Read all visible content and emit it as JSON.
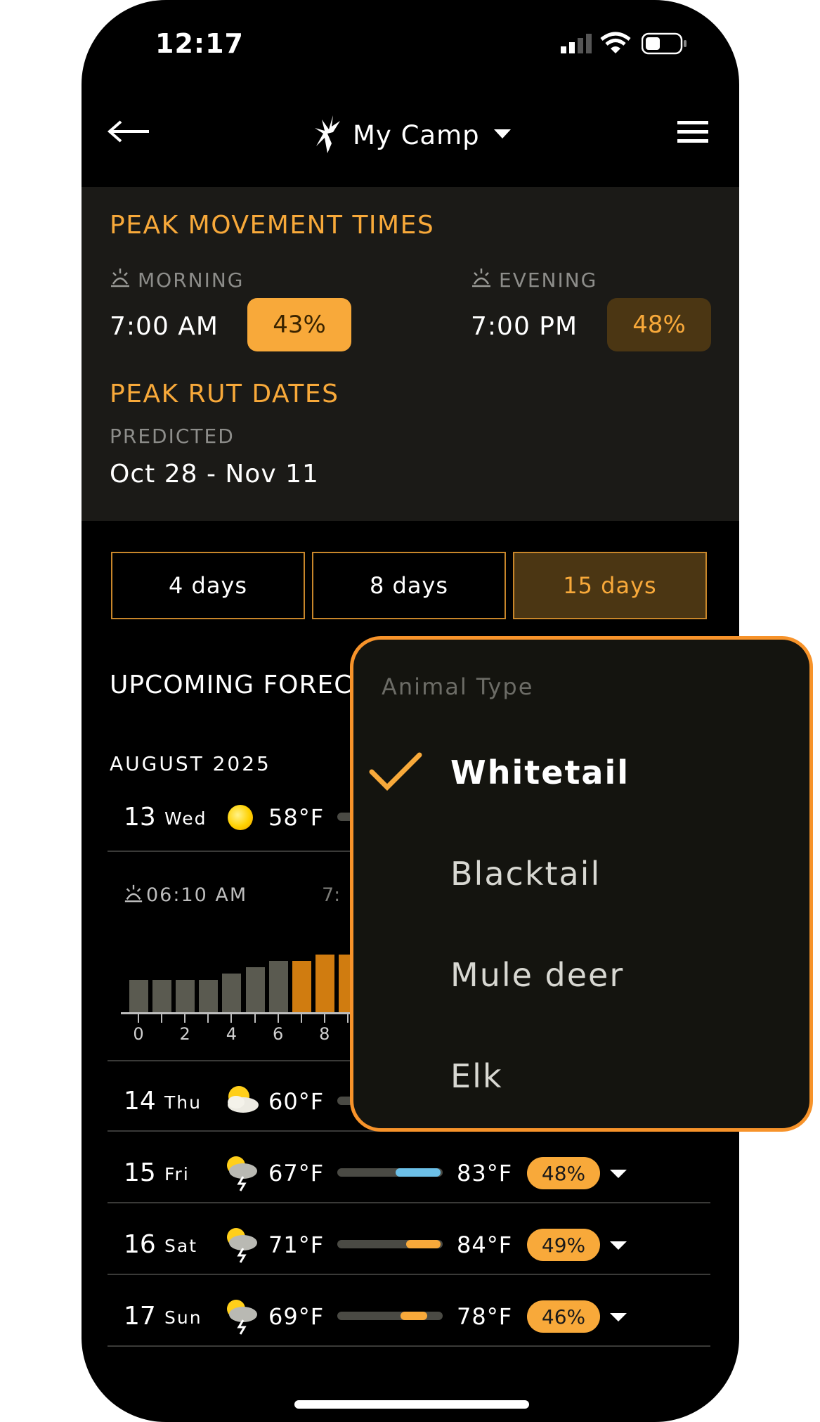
{
  "status_bar": {
    "time": "12:17"
  },
  "header": {
    "camp_name": "My Camp"
  },
  "peak_movement": {
    "title": "PEAK MOVEMENT TIMES",
    "morning": {
      "label": "MORNING",
      "time": "7:00 AM",
      "percent": "43%"
    },
    "evening": {
      "label": "EVENING",
      "time": "7:00 PM",
      "percent": "48%"
    }
  },
  "peak_rut": {
    "title": "PEAK RUT DATES",
    "predicted_label": "PREDICTED",
    "dates": "Oct 28 - Nov 11"
  },
  "range_tabs": [
    {
      "label": "4 days",
      "selected": false
    },
    {
      "label": "8 days",
      "selected": false
    },
    {
      "label": "15 days",
      "selected": true
    }
  ],
  "forecast": {
    "title": "UPCOMING FOREC",
    "month": "AUGUST 2025",
    "expanded_day": {
      "day": "13",
      "weekday": "Wed",
      "low": "58°F",
      "sunrise": "06:10 AM",
      "partial_time": "7:",
      "chart": {
        "x_ticks": [
          "0",
          "2",
          "4",
          "6",
          "8"
        ],
        "hourly_activity": [
          0.4,
          0.4,
          0.4,
          0.4,
          0.48,
          0.56,
          0.64,
          0.64,
          0.72,
          0.72
        ],
        "highlight_from_hour": 7
      }
    },
    "days": [
      {
        "day": "14",
        "weekday": "Thu",
        "low": "60°F",
        "high": "",
        "percent": "",
        "icon": "partly-cloudy-icon"
      },
      {
        "day": "15",
        "weekday": "Fri",
        "low": "67°F",
        "high": "83°F",
        "percent": "48%",
        "icon": "thunderstorm-icon",
        "bar": {
          "start": 0.55,
          "end": 0.98,
          "color": "#6cc0e8"
        }
      },
      {
        "day": "16",
        "weekday": "Sat",
        "low": "71°F",
        "high": "84°F",
        "percent": "49%",
        "icon": "thunderstorm-icon",
        "bar": {
          "start": 0.65,
          "end": 0.98,
          "color": "#f8a93a"
        }
      },
      {
        "day": "17",
        "weekday": "Sun",
        "low": "69°F",
        "high": "78°F",
        "percent": "46%",
        "icon": "thunderstorm-icon",
        "bar": {
          "start": 0.6,
          "end": 0.85,
          "color": "#f8a93a"
        }
      }
    ]
  },
  "animal_popup": {
    "title": "Animal Type",
    "options": [
      {
        "label": "Whitetail",
        "selected": true
      },
      {
        "label": "Blacktail",
        "selected": false
      },
      {
        "label": "Mule deer",
        "selected": false
      },
      {
        "label": "Elk",
        "selected": false
      }
    ]
  },
  "colors": {
    "accent": "#f8a93a",
    "popup_border": "#f7932a",
    "panel": "#1b1a17"
  }
}
